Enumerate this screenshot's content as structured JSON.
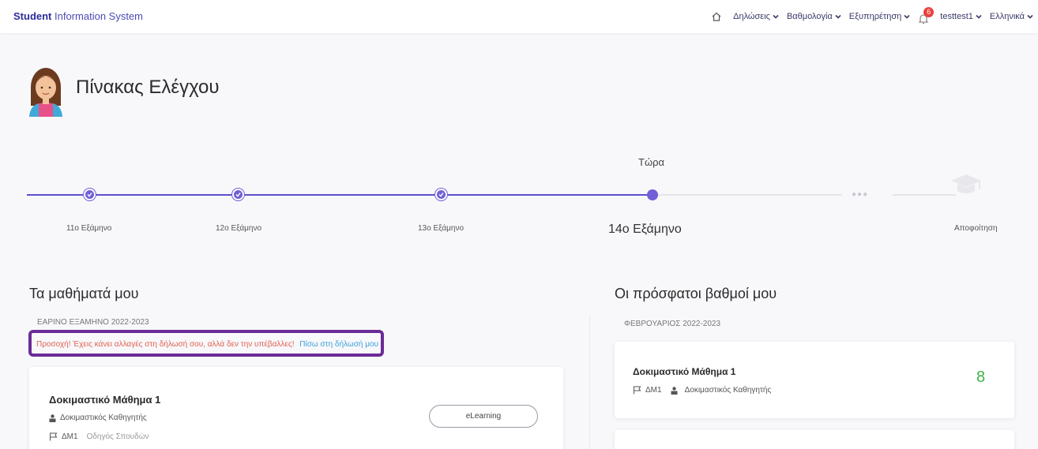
{
  "app": {
    "brand_bold": "Student",
    "brand_rest": "Information System"
  },
  "nav": {
    "items": [
      "Δηλώσεις",
      "Βαθμολογία",
      "Εξυπηρέτηση"
    ],
    "notifications": "6",
    "user": "testtest1",
    "language": "Ελληνικά"
  },
  "page": {
    "title": "Πίνακας Ελέγχου"
  },
  "timeline": {
    "now_label": "Τώρα",
    "steps": [
      "11ο Εξάμηνο",
      "12ο Εξάμηνο",
      "13ο Εξάμηνο",
      "14ο Εξάμηνο"
    ],
    "more": "●●●",
    "graduation": "Αποφοίτηση"
  },
  "courses": {
    "title": "Τα μαθήματά μου",
    "semester": "ΕΑΡΙΝΟ ΕΞΑΜΗΝΟ 2022-2023",
    "warning_text": "Προσοχή! Έχεις κάνει αλλαγές στη δήλωσή σου, αλλά δεν την υπέβαλλες!",
    "warning_link": "Πίσω στη δήλωσή μου",
    "card": {
      "title": "Δοκιμαστικό Μάθημα 1",
      "instructor": "Δοκιμαστικός Καθηγητής",
      "code": "ΔΜ1",
      "guide": "Οδηγός Σπουδών",
      "button": "eLearning"
    }
  },
  "grades": {
    "title": "Οι πρόσφατοι βαθμοί μου",
    "period": "ΦΕΒΡΟΥΑΡΙΟΣ 2022-2023",
    "card": {
      "title": "Δοκιμαστικό Μάθημα 1",
      "code": "ΔΜ1",
      "instructor": "Δοκιμαστικός Καθηγητής",
      "grade": "8"
    }
  },
  "colors": {
    "accent": "#6f60d6",
    "brand": "#2e2d9a",
    "warning_border": "#6a2b96",
    "grade": "#3cb54a"
  }
}
